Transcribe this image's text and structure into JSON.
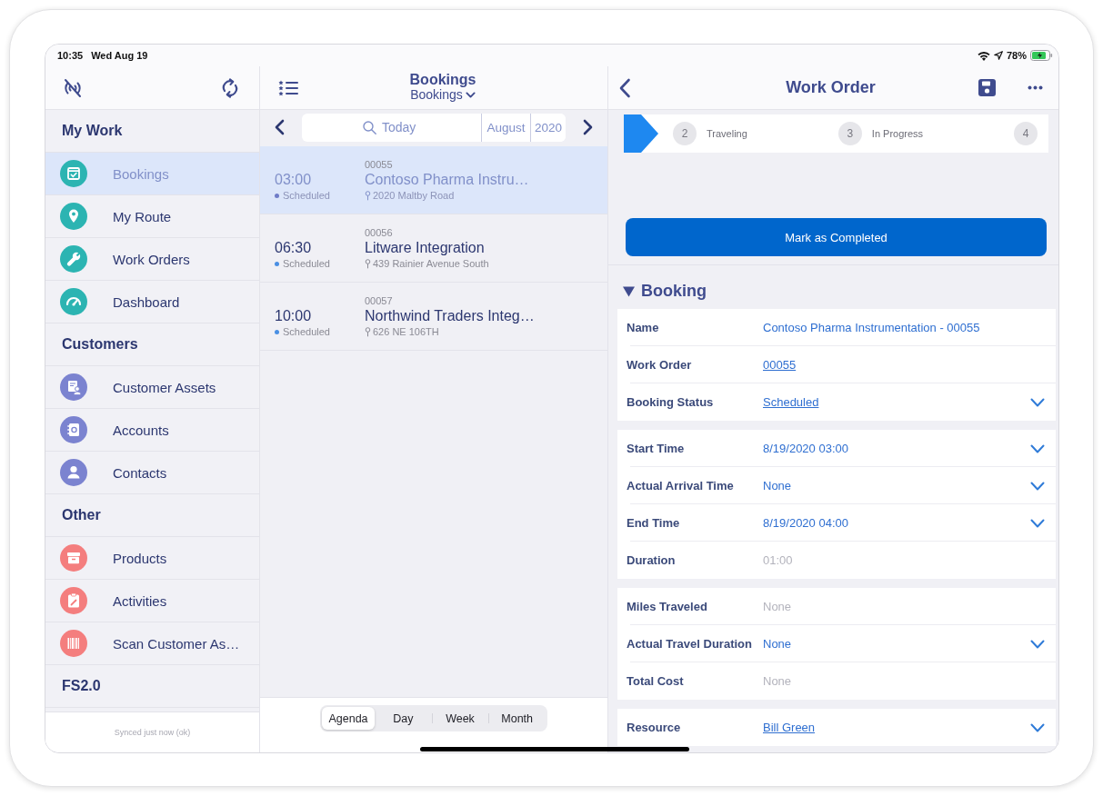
{
  "status_bar": {
    "time": "10:35",
    "date": "Wed Aug 19",
    "battery": "78%"
  },
  "sidebar": {
    "sections": [
      {
        "title": "My Work",
        "color": "#2cb4b2",
        "items": [
          {
            "label": "Bookings",
            "selected": true
          },
          {
            "label": "My Route",
            "selected": false
          },
          {
            "label": "Work Orders",
            "selected": false
          },
          {
            "label": "Dashboard",
            "selected": false
          }
        ]
      },
      {
        "title": "Customers",
        "color": "#7b83d0",
        "items": [
          {
            "label": "Customer Assets",
            "selected": false
          },
          {
            "label": "Accounts",
            "selected": false
          },
          {
            "label": "Contacts",
            "selected": false
          }
        ]
      },
      {
        "title": "Other",
        "color": "#f47e7e",
        "items": [
          {
            "label": "Products",
            "selected": false
          },
          {
            "label": "Activities",
            "selected": false
          },
          {
            "label": "Scan Customer As…",
            "selected": false
          }
        ]
      },
      {
        "title": "FS2.0"
      }
    ],
    "sync_status": "Synced just now (ok)"
  },
  "agenda": {
    "title": "Bookings",
    "view": "Bookings",
    "search": {
      "placeholder": "Today"
    },
    "month": "August",
    "year": "2020",
    "bookings": [
      {
        "number": "00055",
        "time": "03:00",
        "status": "Scheduled",
        "title": "Contoso Pharma Instru…",
        "address": "2020 Maltby Road",
        "selected": true
      },
      {
        "number": "00056",
        "time": "06:30",
        "status": "Scheduled",
        "title": "Litware Integration",
        "address": "439 Rainier Avenue South",
        "selected": false
      },
      {
        "number": "00057",
        "time": "10:00",
        "status": "Scheduled",
        "title": "Northwind Traders Integ…",
        "address": "626 NE 106TH",
        "selected": false
      }
    ],
    "views": [
      {
        "label": "Agenda",
        "selected": true
      },
      {
        "label": "Day",
        "selected": false
      },
      {
        "label": "Week",
        "selected": false
      },
      {
        "label": "Month",
        "selected": false
      }
    ]
  },
  "work_order": {
    "title": "Work Order",
    "stages": [
      {
        "number": "2",
        "label": "Traveling"
      },
      {
        "number": "3",
        "label": "In Progress"
      },
      {
        "number": "4"
      }
    ],
    "action": "Mark as Completed",
    "section": {
      "title": "Booking",
      "expanded": true,
      "groups": [
        {
          "fields": [
            {
              "label": "Name",
              "value": "Contoso Pharma Instrumentation - 00055",
              "kind": "text",
              "dropdown": false
            },
            {
              "label": "Work Order",
              "value": "00055",
              "kind": "link",
              "dropdown": false
            },
            {
              "label": "Booking Status",
              "value": "Scheduled",
              "kind": "link",
              "dropdown": true
            }
          ]
        },
        {
          "fields": [
            {
              "label": "Start Time",
              "value": "8/19/2020 03:00",
              "kind": "text",
              "dropdown": true
            },
            {
              "label": "Actual Arrival Time",
              "value": "None",
              "kind": "text",
              "dropdown": true
            },
            {
              "label": "End Time",
              "value": "8/19/2020 04:00",
              "kind": "text",
              "dropdown": true
            },
            {
              "label": "Duration",
              "value": "01:00",
              "kind": "readonly",
              "dropdown": false
            }
          ]
        },
        {
          "fields": [
            {
              "label": "Miles Traveled",
              "value": "None",
              "kind": "readonly",
              "dropdown": false
            },
            {
              "label": "Actual Travel Duration",
              "value": "None",
              "kind": "text",
              "dropdown": true
            },
            {
              "label": "Total Cost",
              "value": "None",
              "kind": "readonly",
              "dropdown": false
            }
          ]
        },
        {
          "fields": [
            {
              "label": "Resource",
              "value": "Bill Green",
              "kind": "link",
              "dropdown": true
            }
          ]
        }
      ]
    }
  }
}
